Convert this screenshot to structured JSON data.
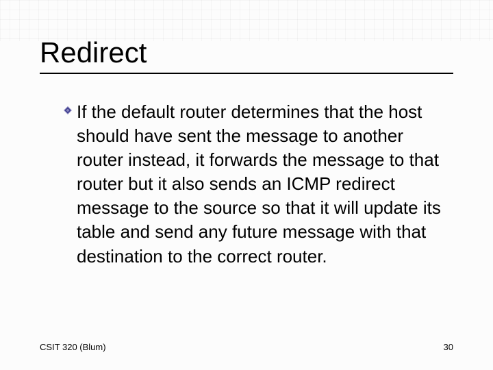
{
  "slide": {
    "title": "Redirect",
    "bullets": [
      {
        "text": "If the default router determines that the host should have sent the message to another router instead, it forwards the message to that router but it also sends an ICMP redirect message to the source so that it will update its table and send any future message with that destination to the correct router."
      }
    ]
  },
  "footer": {
    "left": "CSIT 320 (Blum)",
    "page_number": "30"
  },
  "icons": {
    "bullet": "diamond-bullet-icon"
  },
  "colors": {
    "bullet_fill": "#3a3a8a",
    "bullet_stroke": "#8a86c0"
  }
}
